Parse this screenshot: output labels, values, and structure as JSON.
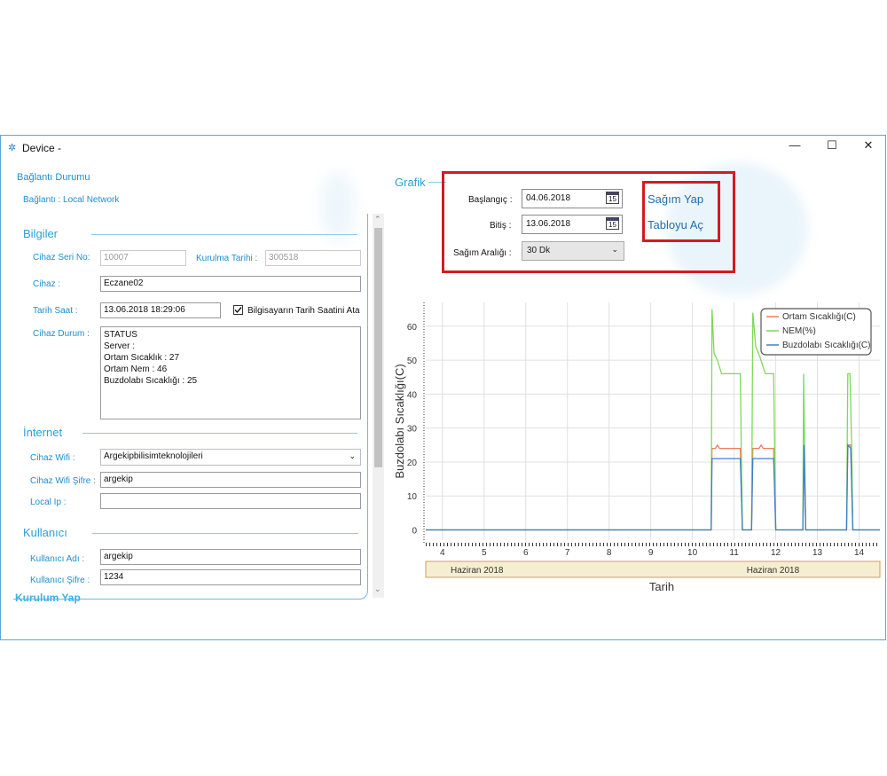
{
  "window": {
    "title": "Device -",
    "minimize": "—",
    "maximize": "☐",
    "close": "✕"
  },
  "connection": {
    "heading": "Bağlantı Durumu",
    "status": "Bağlantı : Local Network"
  },
  "info": {
    "heading": "Bilgiler",
    "serial_label": "Cihaz Seri No:",
    "serial_value": "10007",
    "install_label": "Kurulma Tarihi :",
    "install_value": "300518",
    "device_label": "Cihaz :",
    "device_value": "Eczane02",
    "datetime_label": "Tarih Saat :",
    "datetime_value": "13.06.2018 18:29:06",
    "sync_checkbox_label": "Bilgisayarın Tarih Saatini Ata",
    "sync_checked": true,
    "status_label": "Cihaz Durum :",
    "status_lines": [
      "STATUS",
      " Server :",
      " Ortam Sıcaklık : 27",
      " Ortam Nem : 46",
      " Buzdolabı Sıcaklığı : 25"
    ]
  },
  "internet": {
    "heading": "İnternet",
    "wifi_label": "Cihaz Wifi :",
    "wifi_value": "Argekipbilisimteknolojileri",
    "wifi_pass_label": "Cihaz Wifi Şifre :",
    "wifi_pass_value": "argekip",
    "local_ip_label": "Local Ip :",
    "local_ip_value": ""
  },
  "user": {
    "heading": "Kullanıcı",
    "username_label": "Kullanıcı Adı :",
    "username_value": "argekip",
    "password_label": "Kullanıcı Şifre :",
    "password_value": "1234",
    "install_button": "Kurulum Yap"
  },
  "graph": {
    "heading": "Grafik",
    "start_label": "Başlangıç :",
    "start_value": "04.06.2018",
    "end_label": "Bitiş :",
    "end_value": "13.06.2018",
    "interval_label": "Sağım Aralığı :",
    "interval_value": "30 Dk",
    "cal_icon_text": "15",
    "milk_button": "Sağım Yap",
    "table_button": "Tabloyu Aç"
  },
  "colors": {
    "accent": "#1b8fd0",
    "highlight_box": "#d41a22",
    "series_ambient": "#f07a5e",
    "series_humidity": "#7ed957",
    "series_fridge": "#3d7fd0"
  },
  "chart_data": {
    "type": "line",
    "ylabel": "Buzdolabı Sıcaklığı(C)",
    "xlabel": "Tarih",
    "ylim": [
      -3,
      67
    ],
    "xlim": [
      3.6,
      14.5
    ],
    "yticks": [
      0,
      10,
      20,
      30,
      40,
      50,
      60
    ],
    "xticks": [
      4,
      5,
      6,
      7,
      8,
      9,
      10,
      11,
      12,
      13,
      14
    ],
    "month_band_labels": [
      "Haziran 2018",
      "Haziran 2018"
    ],
    "grid": true,
    "legend_position": "top-right",
    "series": [
      {
        "name": "Ortam Sıcaklığı(C)",
        "color": "#f07a5e",
        "points": [
          [
            3.6,
            0
          ],
          [
            10.45,
            0
          ],
          [
            10.47,
            24
          ],
          [
            10.55,
            24
          ],
          [
            10.6,
            25
          ],
          [
            10.65,
            24
          ],
          [
            11.15,
            24
          ],
          [
            11.2,
            0
          ],
          [
            11.42,
            0
          ],
          [
            11.45,
            24
          ],
          [
            11.6,
            24
          ],
          [
            11.65,
            25
          ],
          [
            11.7,
            24
          ],
          [
            11.95,
            24
          ],
          [
            12,
            0
          ],
          [
            12.65,
            0
          ],
          [
            12.68,
            24
          ],
          [
            12.72,
            0
          ],
          [
            13.7,
            0
          ],
          [
            13.73,
            25
          ],
          [
            13.8,
            25
          ],
          [
            13.85,
            0
          ],
          [
            14.5,
            0
          ]
        ]
      },
      {
        "name": "NEM(%)",
        "color": "#7ed957",
        "points": [
          [
            3.6,
            0
          ],
          [
            10.45,
            0
          ],
          [
            10.47,
            65
          ],
          [
            10.52,
            52
          ],
          [
            10.6,
            50
          ],
          [
            10.7,
            46
          ],
          [
            11.15,
            46
          ],
          [
            11.2,
            0
          ],
          [
            11.42,
            0
          ],
          [
            11.45,
            64
          ],
          [
            11.52,
            54
          ],
          [
            11.62,
            51
          ],
          [
            11.75,
            46
          ],
          [
            11.95,
            46
          ],
          [
            12,
            0
          ],
          [
            12.65,
            0
          ],
          [
            12.67,
            46
          ],
          [
            12.72,
            0
          ],
          [
            13.7,
            0
          ],
          [
            13.73,
            46
          ],
          [
            13.78,
            46
          ],
          [
            13.82,
            26
          ],
          [
            13.85,
            0
          ],
          [
            14.5,
            0
          ]
        ]
      },
      {
        "name": "Buzdolabı Sıcaklığı(C)",
        "color": "#3d7fd0",
        "points": [
          [
            3.6,
            0
          ],
          [
            10.45,
            0
          ],
          [
            10.47,
            21
          ],
          [
            11.15,
            21
          ],
          [
            11.2,
            0
          ],
          [
            11.42,
            0
          ],
          [
            11.45,
            21
          ],
          [
            11.95,
            21
          ],
          [
            12,
            0
          ],
          [
            12.65,
            0
          ],
          [
            12.68,
            25
          ],
          [
            12.72,
            0
          ],
          [
            13.7,
            0
          ],
          [
            13.73,
            25
          ],
          [
            13.8,
            24
          ],
          [
            13.85,
            0
          ],
          [
            14.5,
            0
          ]
        ]
      }
    ]
  }
}
